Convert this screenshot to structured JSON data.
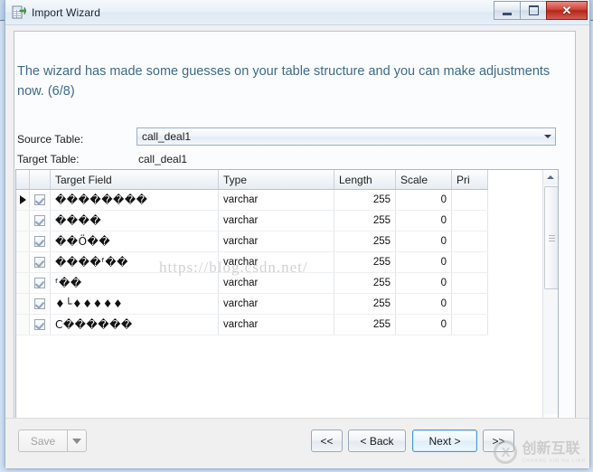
{
  "window": {
    "title": "Import Wizard",
    "icon": "import-wizard-icon",
    "controls": {
      "minimize": "–",
      "maximize": "□",
      "close": "✕"
    }
  },
  "heading": "The wizard has made some guesses on your table structure and you can make adjustments now. (6/8)",
  "fields": {
    "source_table_label": "Source Table:",
    "source_table_value": "call_deal1",
    "target_table_label": "Target Table:",
    "target_table_value": "call_deal1"
  },
  "grid": {
    "columns": [
      "Target Field",
      "Type",
      "Length",
      "Scale",
      "Pri"
    ],
    "rows": [
      {
        "checked": true,
        "current": true,
        "field": "��������",
        "type": "varchar",
        "length": "255",
        "scale": "0",
        "pri": ""
      },
      {
        "checked": true,
        "current": false,
        "field": "����",
        "type": "varchar",
        "length": "255",
        "scale": "0",
        "pri": ""
      },
      {
        "checked": true,
        "current": false,
        "field": "��Ö��",
        "type": "varchar",
        "length": "255",
        "scale": "0",
        "pri": ""
      },
      {
        "checked": true,
        "current": false,
        "field": "����ᶠ��",
        "type": "varchar",
        "length": "255",
        "scale": "0",
        "pri": ""
      },
      {
        "checked": true,
        "current": false,
        "field": "ᶠ��",
        "type": "varchar",
        "length": "255",
        "scale": "0",
        "pri": ""
      },
      {
        "checked": true,
        "current": false,
        "field": "♦└♦♦♦♦♦",
        "type": "varchar",
        "length": "255",
        "scale": "0",
        "pri": ""
      },
      {
        "checked": true,
        "current": false,
        "field": "C������",
        "type": "varchar",
        "length": "255",
        "scale": "0",
        "pri": ""
      }
    ]
  },
  "footer": {
    "save_label": "Save",
    "save_dropdown_icon": "chevron-down-icon",
    "first_label": "<<",
    "back_label": "< Back",
    "next_label": "Next >",
    "last_label": ">>"
  },
  "watermarks": {
    "url": "https://blog.csdn.net/",
    "logo_mark": "X",
    "logo_text": "创新互联",
    "logo_sub": "CHUANG XIN HU LIAN"
  },
  "colors": {
    "heading": "#3d6b8e",
    "close_button": "#cf4338",
    "focus_border": "#3c9ad4",
    "window_bg": "#f0f0f0",
    "desktop_bg": "#d3e3f4"
  }
}
